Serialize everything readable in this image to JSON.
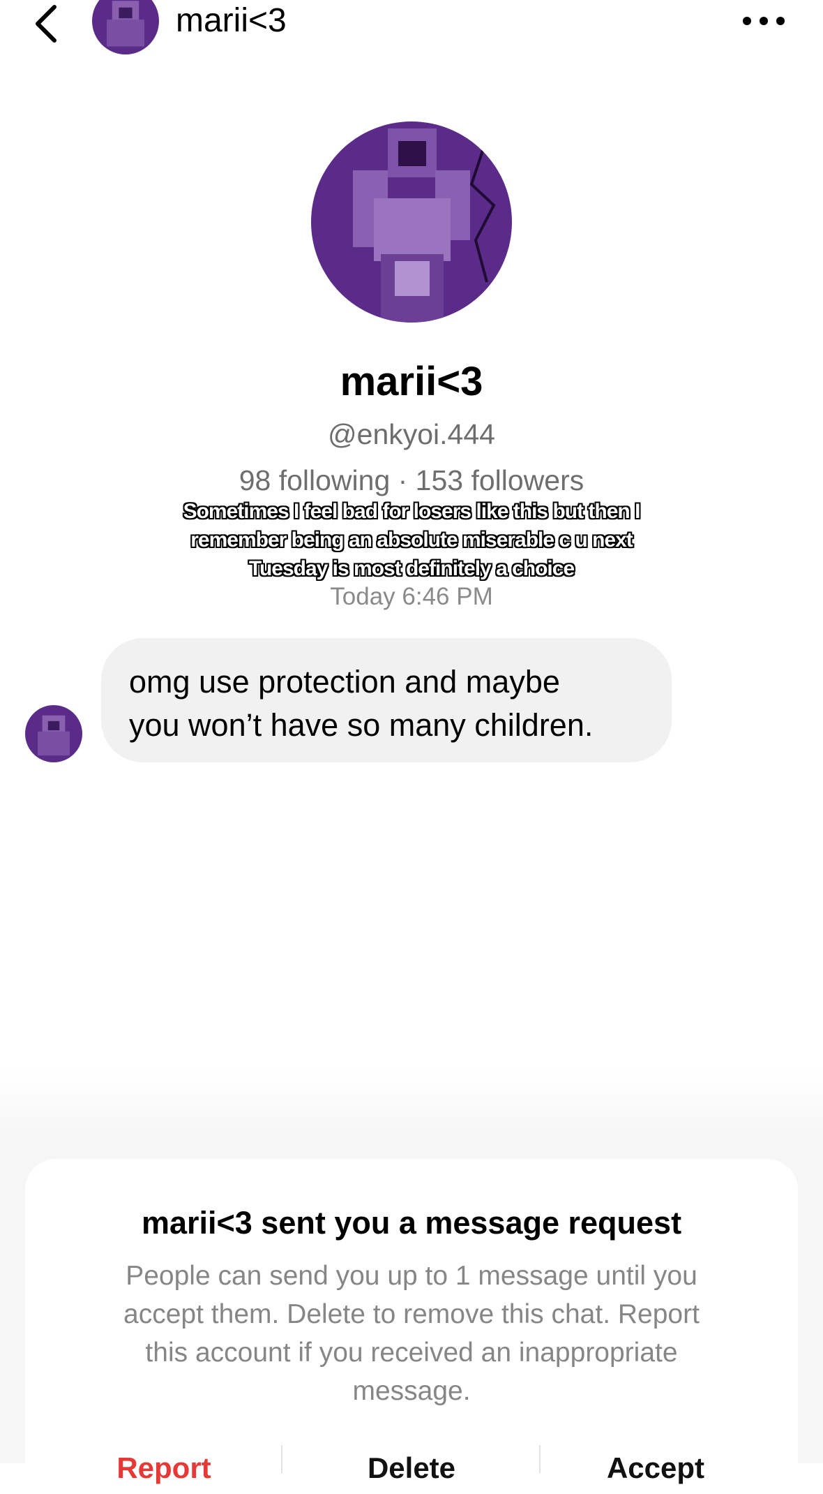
{
  "header": {
    "title": "marii<3",
    "back_icon": "chevron-left-icon",
    "more_icon": "more-horizontal-icon"
  },
  "profile": {
    "name": "marii<3",
    "handle": "@enkyoi.444",
    "stats": "98 following · 153 followers",
    "avatar_color": "#5b2b8a"
  },
  "caption": {
    "lines": [
      "Sometimes I feel bad for losers like this but then I",
      "remember being an absolute miserable c u next",
      "Tuesday is most definitely a choice"
    ]
  },
  "conversation": {
    "timestamp": "Today 6:46 PM",
    "messages": [
      {
        "lines": [
          "omg use protection and maybe",
          "you won’t have so many children."
        ]
      }
    ]
  },
  "request_card": {
    "title": "marii<3 sent you a message request",
    "body": [
      "People can send you up to 1 message until you",
      "accept them. Delete to remove this chat. Report",
      "this account if you received an inappropriate",
      "message."
    ],
    "actions": {
      "report": "Report",
      "delete": "Delete",
      "accept": "Accept"
    },
    "report_color": "#e53935"
  }
}
